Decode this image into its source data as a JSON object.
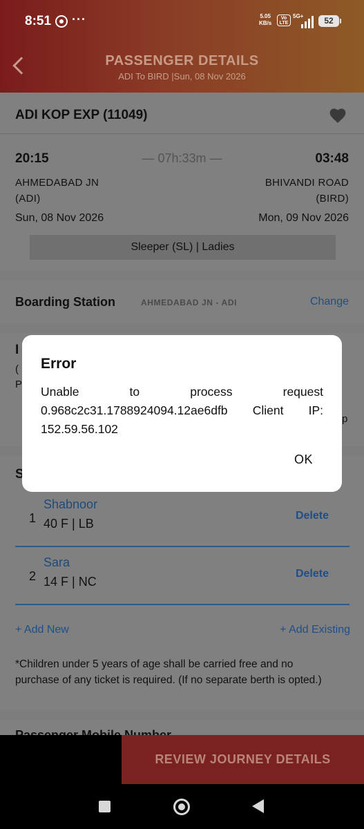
{
  "status_bar": {
    "time": "8:51",
    "dots": "···",
    "net_speed_value": "5.05",
    "net_speed_unit": "KB/s",
    "volte_top": "Vo",
    "volte_bottom": "LTE",
    "signal_label": "5G+",
    "battery": "52"
  },
  "header": {
    "title": "PASSENGER DETAILS",
    "subtitle": "ADI To BIRD |Sun, 08 Nov 2026"
  },
  "train": {
    "name": "ADI KOP  EXP (11049)"
  },
  "journey": {
    "departure_time": "20:15",
    "arrival_time": "03:48",
    "duration": "— 07h:33m —",
    "from_station": "AHMEDABAD JN",
    "from_code": "(ADI)",
    "to_station": "BHIVANDI ROAD",
    "to_code": "(BIRD)",
    "departure_date": "Sun, 08 Nov 2026",
    "arrival_date": "Mon, 09 Nov 2026",
    "class_quota": "Sleeper (SL) | Ladies"
  },
  "boarding": {
    "label": "Boarding Station",
    "value": "AHMEDABAD JN - ADI",
    "change": "Change"
  },
  "insurance_fragments": {
    "a": "I",
    "b": "(",
    "c": "P",
    "d": "p"
  },
  "passengers_section": {
    "heading_fragment": "S",
    "items": [
      {
        "index": "1",
        "name": "Shabnoor",
        "meta": "40 F | LB",
        "delete": "Delete"
      },
      {
        "index": "2",
        "name": "Sara",
        "meta": "14 F | NC",
        "delete": "Delete"
      }
    ],
    "add_new": "+ Add New",
    "add_existing": "+ Add Existing",
    "note": "*Children under 5 years of age shall be carried free and no purchase of any ticket is required. (If no separate berth is opted.)"
  },
  "mobile": {
    "label": "Passenger Mobile Number"
  },
  "footer": {
    "review_button": "REVIEW JOURNEY DETAILS"
  },
  "dialog": {
    "title": "Error",
    "message": "Unable to process request 0.968c2c31.1788924094.12ae6dfb Client IP: 152.59.56.102",
    "ok": "OK"
  },
  "colors": {
    "header_start": "#7a1c1c",
    "header_end": "#8e5a26",
    "link_blue": "#1f4f86",
    "button_red": "#7a2222"
  }
}
